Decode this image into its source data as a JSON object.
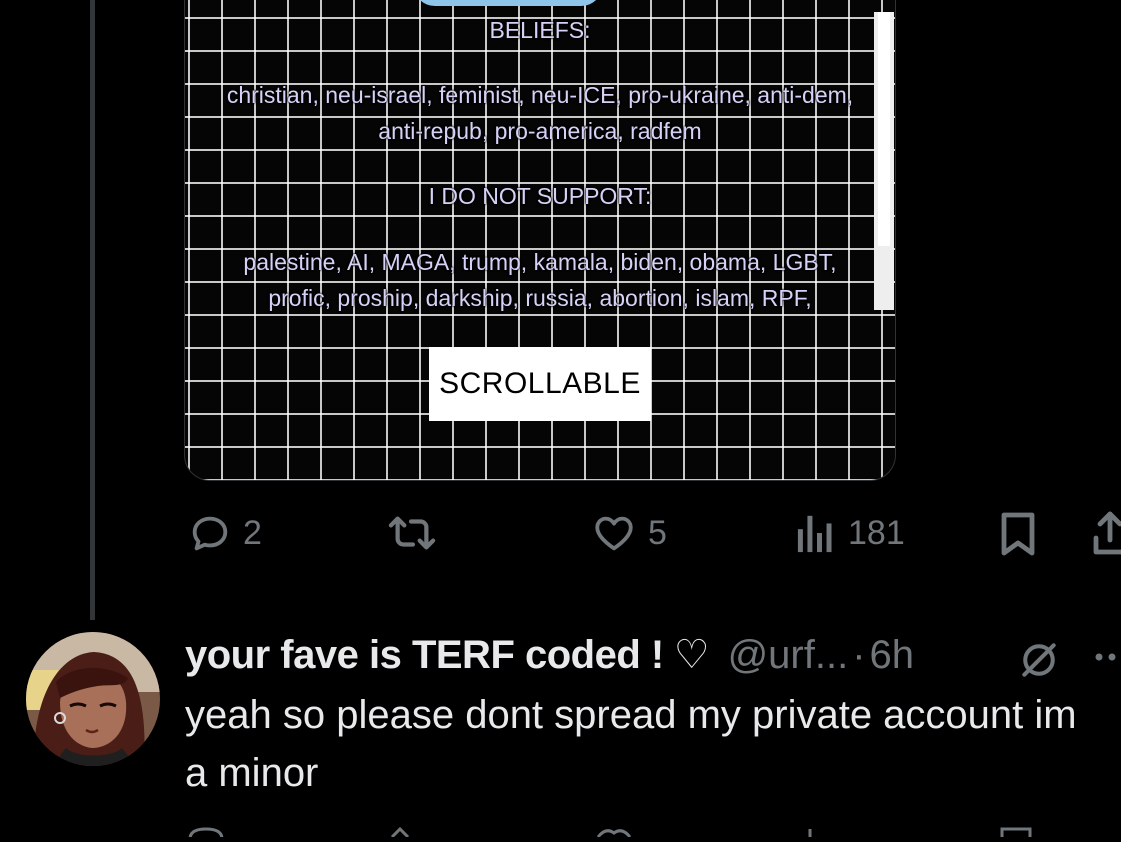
{
  "card": {
    "beliefs_heading": "BELIEFS:",
    "beliefs_list": "christian, neu-israel, feminist, neu-ICE, pro-ukraine, anti-dem, anti-repub, pro-america, radfem",
    "not_support_heading": "I DO NOT SUPPORT:",
    "not_support_list": "palestine, AI, MAGA, trump, kamala, biden, obama, LGBT, profic, proship, darkship, russia, abortion, islam, RPF,",
    "scroll_button": "SCROLLABLE"
  },
  "actions": {
    "reply_count": "2",
    "retweet_count": "",
    "like_count": "5",
    "views_count": "181"
  },
  "reply": {
    "display_name": "your fave is TERF coded !",
    "name_glyph": "♡",
    "handle": "@urf...",
    "dot": "·",
    "time": "6h",
    "text": "yeah so please dont spread my private account im a minor"
  },
  "icons": {
    "reply": "comment-icon",
    "retweet": "retweet-icon",
    "like": "heart-icon",
    "views": "views-chart-icon",
    "bookmark": "bookmark-icon",
    "share": "share-icon",
    "muted": "muted-circle-slash-icon",
    "more": "more-dots-icon"
  },
  "colors": {
    "background": "#000000",
    "text_primary": "#e7e9ea",
    "text_secondary": "#71767b",
    "card_text": "#d6d2f7",
    "thread_line": "#333639"
  }
}
